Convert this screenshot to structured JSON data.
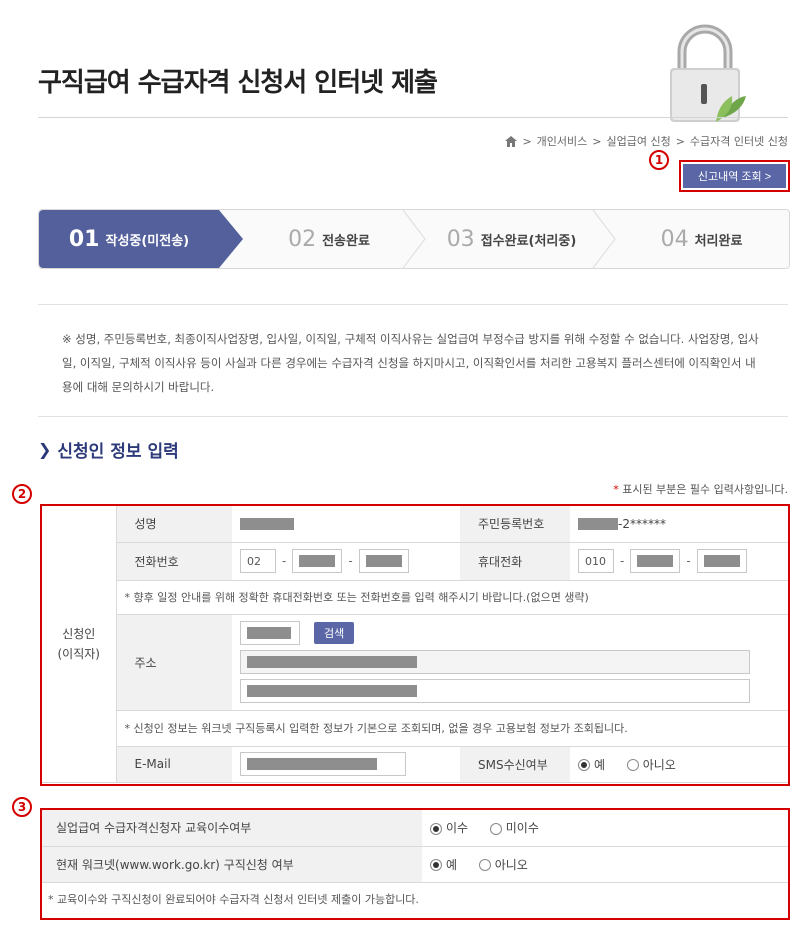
{
  "page": {
    "title": "구직급여 수급자격 신청서 인터넷 제출"
  },
  "breadcrumb": [
    "개인서비스",
    "실업급여 신청",
    "수급자격 인터넷 신청"
  ],
  "markers": [
    "1",
    "2",
    "3"
  ],
  "inquiry_button": "신고내역 조회 >",
  "steps": [
    {
      "num": "01",
      "label": "작성중(미전송)"
    },
    {
      "num": "02",
      "label": "전송완료"
    },
    {
      "num": "03",
      "label": "접수완료(처리중)"
    },
    {
      "num": "04",
      "label": "처리완료"
    }
  ],
  "notice": "※ 성명, 주민등록번호, 최종이직사업장명, 입사일, 이직일, 구체적 이직사유는 실업급여 부정수급 방지를 위해 수정할 수 없습니다. 사업장명, 입사일, 이직일, 구체적 이직사유 등이 사실과 다른 경우에는 수급자격 신청을 하지마시고, 이직확인서를 처리한 고용복지 플러스센터에 이직확인서 내용에 대해 문의하시기 바랍니다.",
  "section": {
    "title": "신청인 정보 입력"
  },
  "required_note": {
    "star": "*",
    "text": "표시된 부분은 필수 입력사항입니다."
  },
  "applicant": {
    "group_label_line1": "신청인",
    "group_label_line2": "(이직자)",
    "name_label": "성명",
    "rrn_label": "주민등록번호",
    "rrn_suffix": "-2******",
    "phone_label": "전화번호",
    "phone_prefix": "02",
    "mobile_label": "휴대전화",
    "mobile_prefix": "010",
    "phone_note": "* 향후 일정 안내를 위해 정확한 휴대전화번호 또는 전화번호를 입력 해주시기 바랍니다.(없으면 생략)",
    "address_label": "주소",
    "search_button": "검색",
    "info_note": "* 신청인 정보는 워크넷 구직등록시 입력한 정보가 기본으로 조회되며, 없을 경우 고용보험 정보가 조회됩니다.",
    "email_label": "E-Mail",
    "sms_label": "SMS수신여부",
    "sms_yes": "예",
    "sms_no": "아니오"
  },
  "education": {
    "q1": "실업급여 수급자격신청자 교육이수여부",
    "q1_opt1": "이수",
    "q1_opt2": "미이수",
    "q2": "현재 워크넷(www.work.go.kr) 구직신청 여부",
    "q2_opt1": "예",
    "q2_opt2": "아니오",
    "note": "* 교육이수와 구직신청이 완료되어야 수급자격 신청서 인터넷 제출이 가능합니다."
  },
  "colors": {
    "accent": "#5a66a6",
    "step_active": "#53609c",
    "highlight": "#d40000",
    "section_title": "#2d3a7a"
  }
}
